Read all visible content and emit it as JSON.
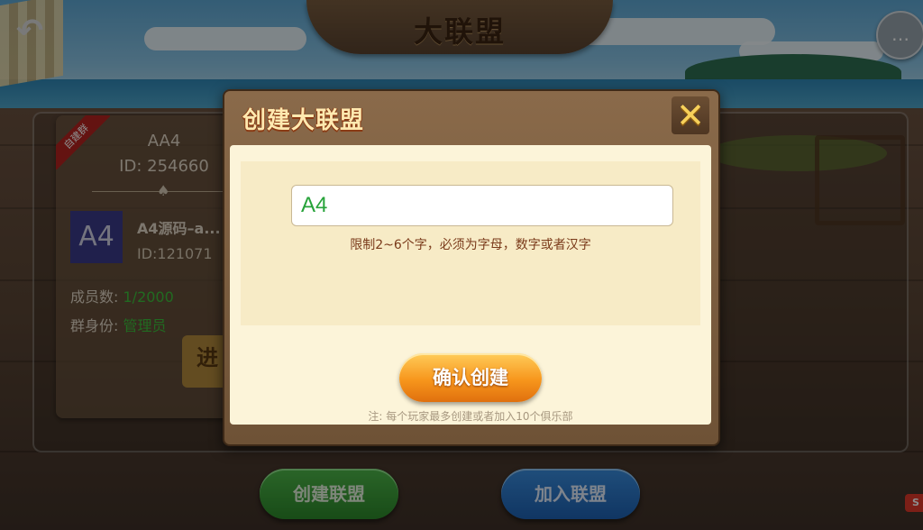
{
  "header": {
    "title": "大联盟"
  },
  "club_card": {
    "badge": "自建群",
    "name": "AA4",
    "id": "ID: 254660",
    "logo_text": "A4",
    "sub_name": "A4源码–a...",
    "sub_id": "ID:121071",
    "members_label": "成员数:",
    "members_value": "1/2000",
    "role_label": "群身份:",
    "role_value": "管理员",
    "enter_label": "进"
  },
  "ghost_card": {
    "name": "A4"
  },
  "bottom": {
    "create_label": "创建联盟",
    "join_label": "加入联盟"
  },
  "corner_mark": "S",
  "modal": {
    "title": "创建大联盟",
    "input_value": "A4",
    "hint": "限制2~6个字，必须为字母，数字或者汉字",
    "confirm_label": "确认创建",
    "note": "注: 每个玩家最多创建或者加入10个俱乐部"
  },
  "colors": {
    "accent_green": "#3cc23c",
    "confirm_orange": "#f7961c",
    "join_blue": "#1e62b4",
    "create_green": "#2d8a2b"
  },
  "icons": {
    "back": "back-arrow-icon",
    "chat": "chat-bubble-icon",
    "close": "close-x-icon",
    "spade": "spade-icon"
  }
}
